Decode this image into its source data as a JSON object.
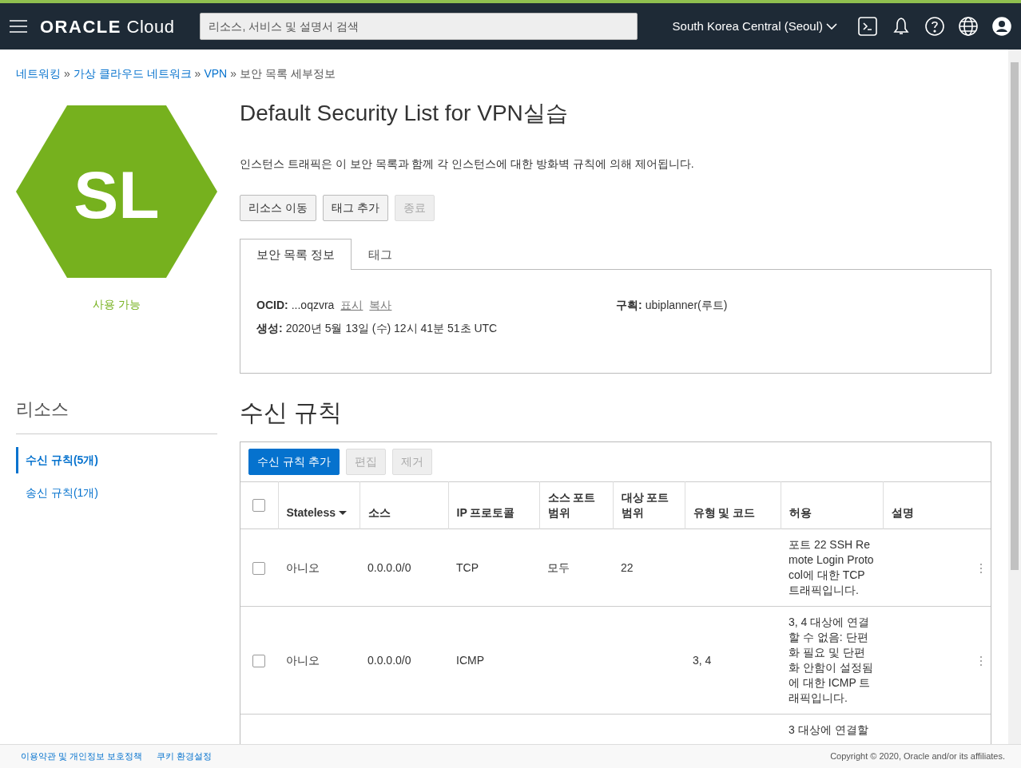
{
  "top_bar": {
    "logo": {
      "brand": "ORACLE",
      "product": "Cloud"
    },
    "search": {
      "placeholder": "리소스, 서비스 및 설명서 검색"
    },
    "region": "South Korea Central (Seoul)"
  },
  "breadcrumb": [
    {
      "label": "네트워킹",
      "link": true
    },
    {
      "separator": "»",
      "label": "가상 클라우드 네트워크",
      "link": true
    },
    {
      "separator": "»",
      "label": "VPN",
      "link": true
    },
    {
      "separator": "»",
      "label": "보안 목록 세부정보",
      "link": false
    }
  ],
  "resource": {
    "badge": "SL",
    "status": "사용 가능"
  },
  "title": "Default Security List for VPN실습",
  "description": "인스턴스 트래픽은 이 보안 목록과 함께 각 인스턴스에 대한 방화벽 규칙에 의해 제어됩니다.",
  "actions": [
    {
      "label": "리소스 이동",
      "disabled": false
    },
    {
      "label": "태그 추가",
      "disabled": false
    },
    {
      "label": "종료",
      "disabled": true
    }
  ],
  "tabs": [
    {
      "label": "보안 목록 정보",
      "selected": true
    },
    {
      "label": "태그",
      "selected": false
    }
  ],
  "info": [
    {
      "label": "OCID:",
      "value": "...oqzvra",
      "links": [
        "표시",
        "복사"
      ]
    },
    {
      "label": "구획:",
      "value": "ubiplanner(루트)"
    },
    {
      "label": "생성:",
      "value": "2020년 5월 13일 (수) 12시 41분 51초 UTC"
    }
  ],
  "resources_title": "리소스",
  "side_nav": [
    {
      "label": "수신 규칙(5개)",
      "selected": true
    },
    {
      "label": "송신 규칙(1개)",
      "selected": false
    }
  ],
  "rules_title": "수신 규칙",
  "toolbar": [
    {
      "label": "수신 규칙 추가",
      "kind": "primary",
      "disabled": false
    },
    {
      "label": "편집",
      "kind": "secondary",
      "disabled": true
    },
    {
      "label": "제거",
      "kind": "secondary",
      "disabled": true
    }
  ],
  "table": {
    "select_all": {
      "checked": false
    },
    "columns": [
      {
        "label": "Stateless",
        "sortable": true
      },
      {
        "label": "소스"
      },
      {
        "label": "IP 프로토콜"
      },
      {
        "label": "소스 포트 범위"
      },
      {
        "label": "대상 포트 범위"
      },
      {
        "label": "유형 및 코드"
      },
      {
        "label": "허용"
      },
      {
        "label": "설명"
      }
    ],
    "rows": [
      {
        "checked": false,
        "cells": [
          "아니오",
          "0.0.0.0/0",
          "TCP",
          "모두",
          "22",
          "",
          "포트 22 SSH Remote Login Protocol에 대한 TCP 트래픽입니다.",
          ""
        ]
      },
      {
        "checked": false,
        "cells": [
          "아니오",
          "0.0.0.0/0",
          "ICMP",
          "",
          "",
          "3, 4",
          "3, 4 대상에 연결할 수 없음: 단편화 필요 및 단편화 안함이 설정됨에 대한 ICMP 트래픽입니다.",
          ""
        ]
      },
      {
        "cells": [
          "",
          "",
          "",
          "",
          "",
          "",
          "3 대상에 연결할",
          ""
        ]
      }
    ]
  },
  "footer": {
    "links": [
      "이용약관 및 개인정보 보호정책",
      "쿠키 환경설정"
    ],
    "copyright": "Copyright © 2020, Oracle and/or its affiliates."
  }
}
